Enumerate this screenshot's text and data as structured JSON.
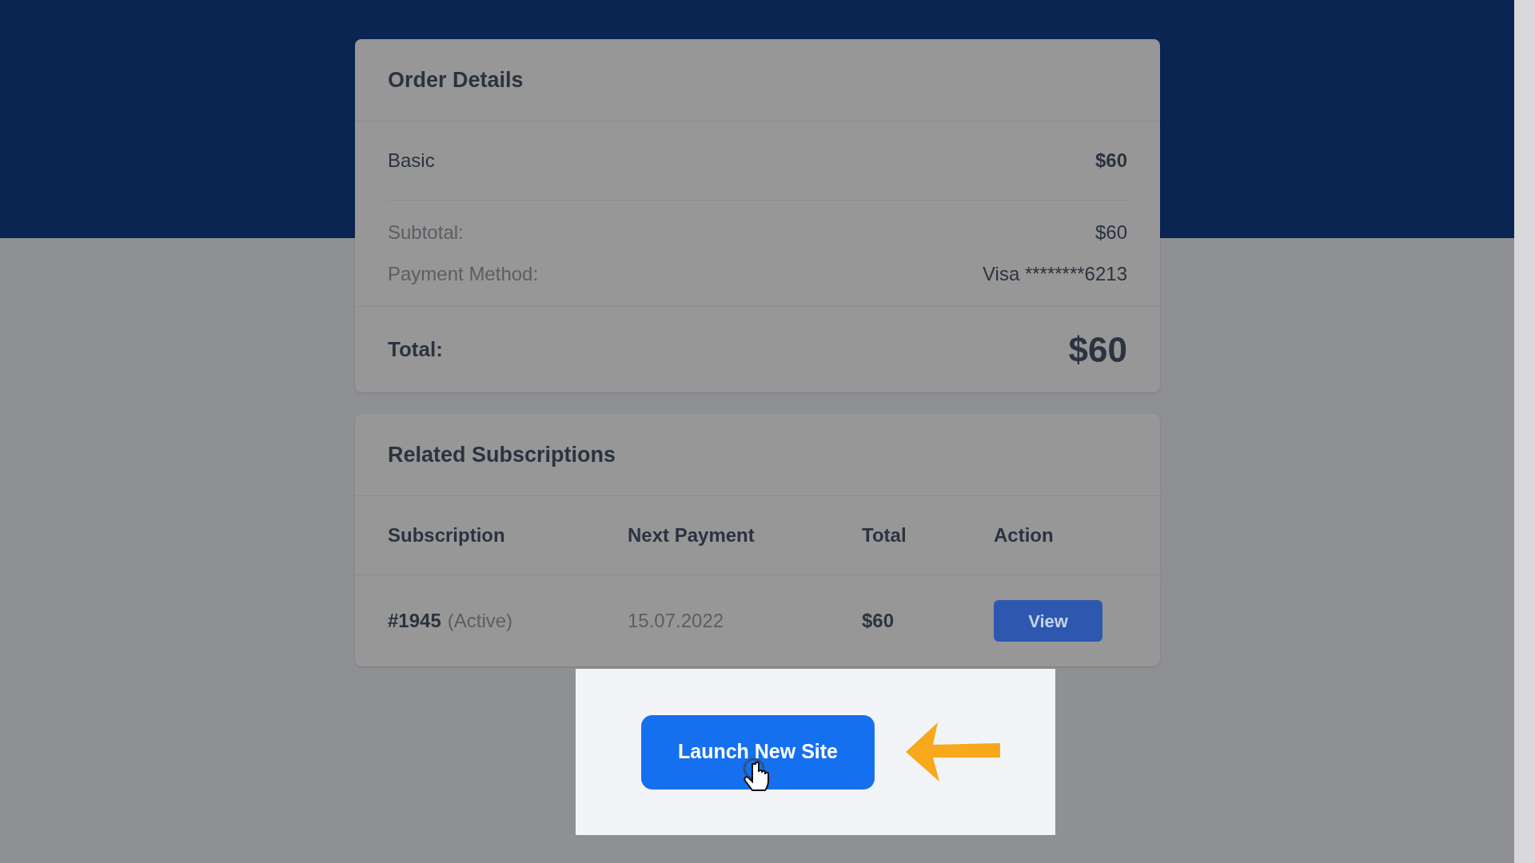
{
  "order_details": {
    "title": "Order Details",
    "items": [
      {
        "label": "Basic",
        "amount": "$60"
      }
    ],
    "summary": [
      {
        "label": "Subtotal:",
        "value": "$60"
      },
      {
        "label": "Payment Method:",
        "value": "Visa ********6213"
      }
    ],
    "total": {
      "label": "Total:",
      "value": "$60"
    }
  },
  "related_subscriptions": {
    "title": "Related Subscriptions",
    "columns": [
      "Subscription",
      "Next Payment",
      "Total",
      "Action"
    ],
    "rows": [
      {
        "subscription": "#1945",
        "status": "(Active)",
        "next_payment": "15.07.2022",
        "total": "$60",
        "action": "View"
      }
    ]
  },
  "launch_button": {
    "label": "Launch New Site"
  }
}
